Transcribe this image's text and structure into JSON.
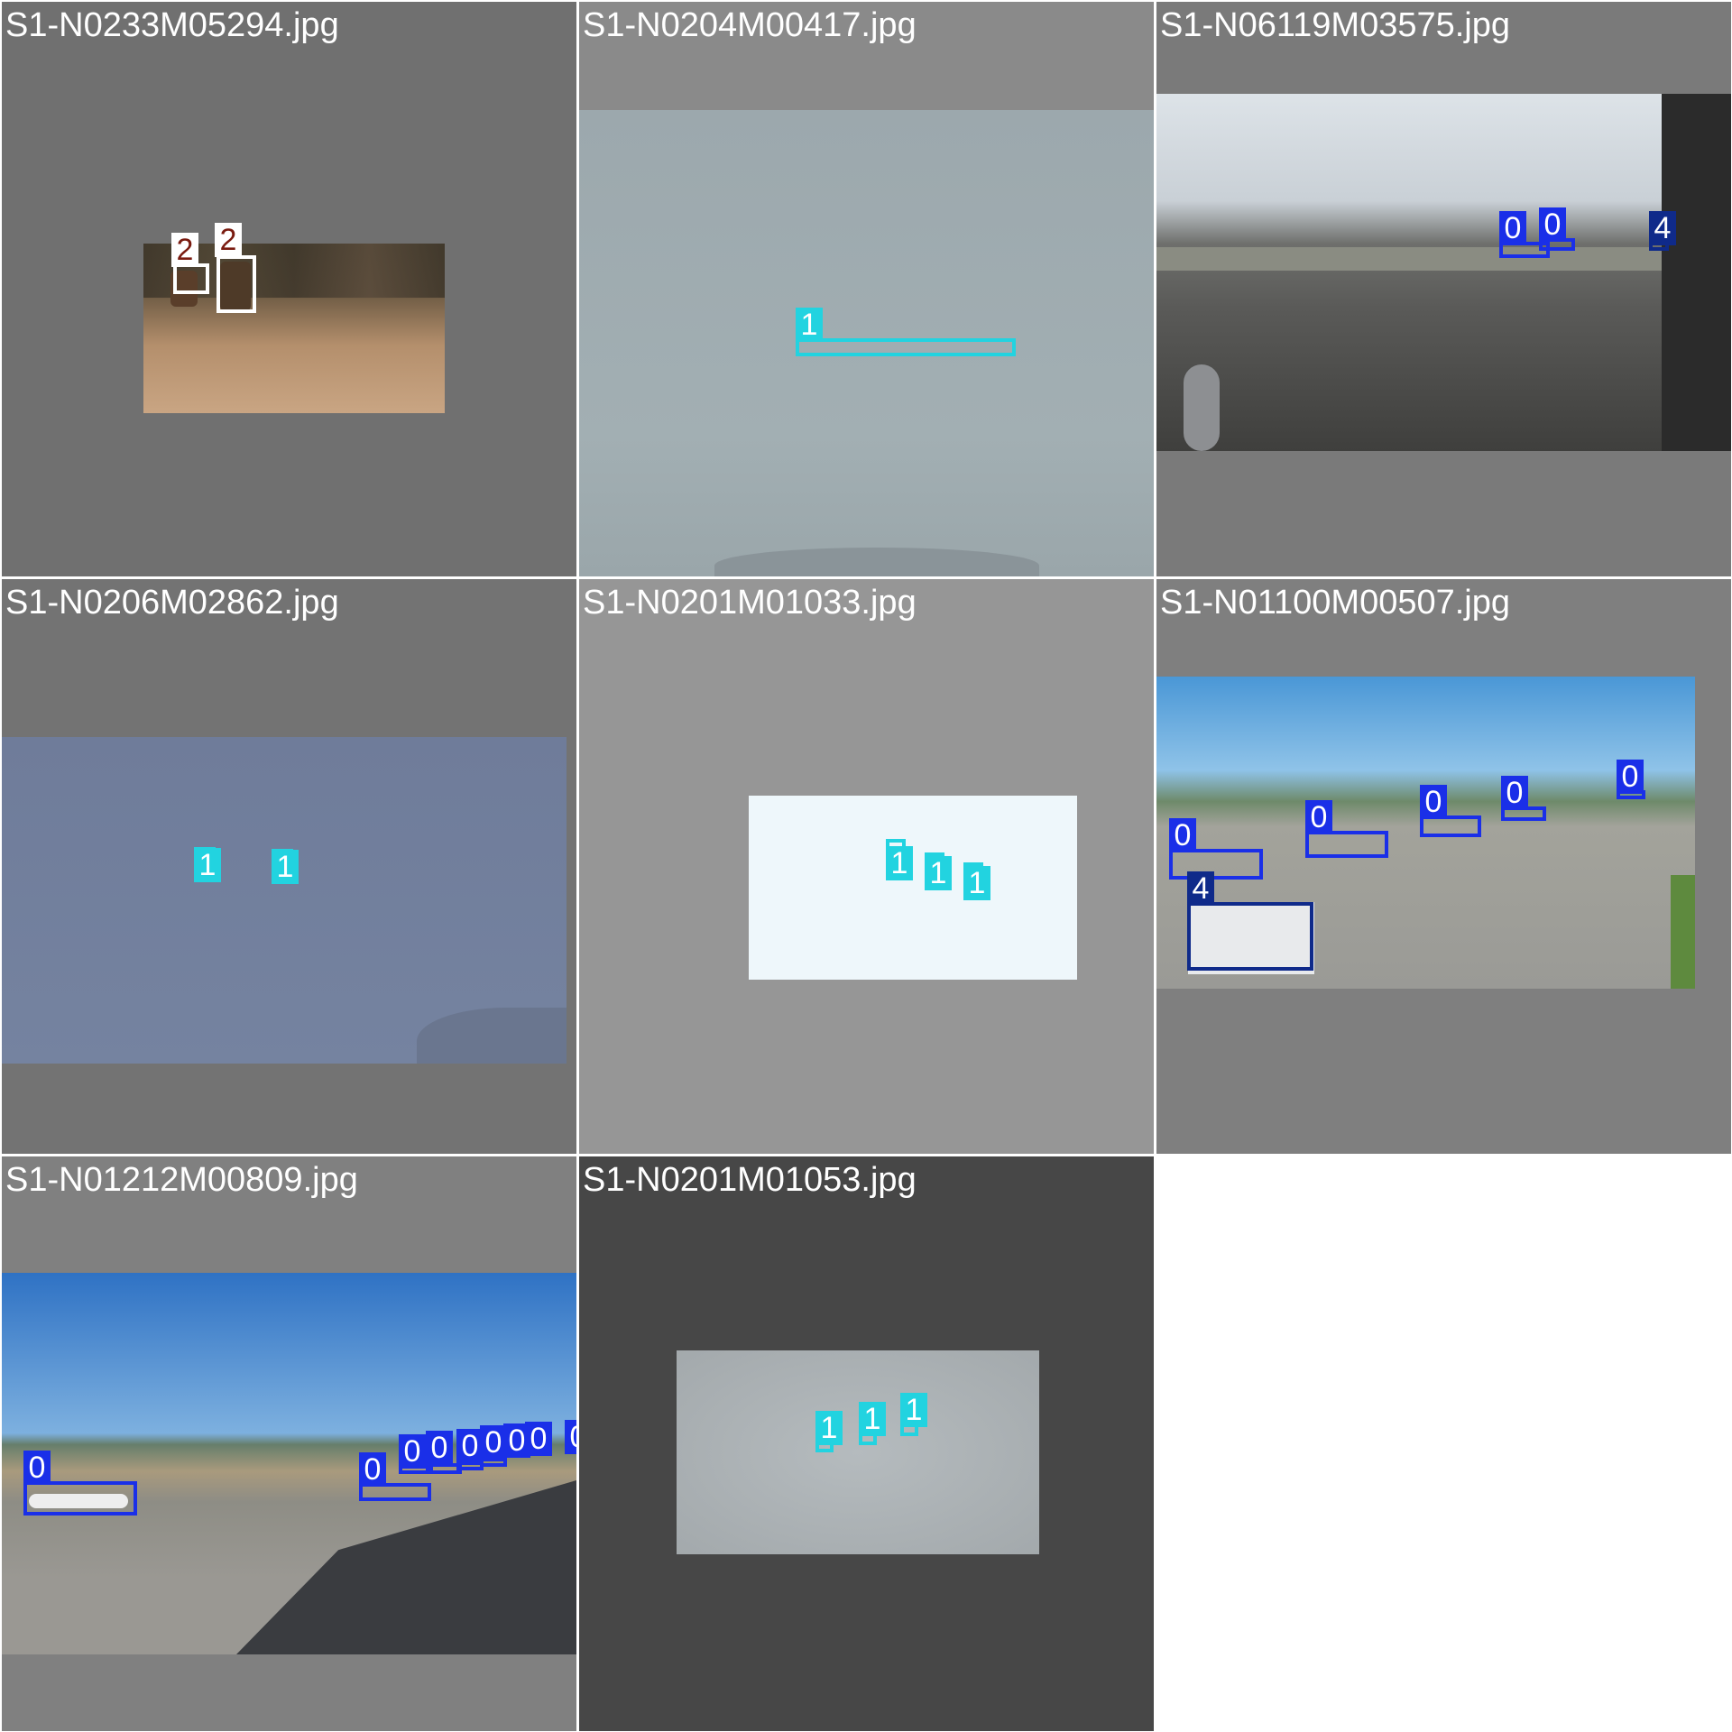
{
  "tiles": [
    {
      "filename": "S1-N0233M05294.jpg",
      "background": "#707070"
    },
    {
      "filename": "S1-N0204M00417.jpg",
      "background": "#8a8a8a"
    },
    {
      "filename": "S1-N06119M03575.jpg",
      "background": "#7a7a7a"
    },
    {
      "filename": "S1-N0206M02862.jpg",
      "background": "#737373"
    },
    {
      "filename": "S1-N0201M01033.jpg",
      "background": "#969696"
    },
    {
      "filename": "S1-N01100M00507.jpg",
      "background": "#7f7f7f"
    },
    {
      "filename": "S1-N01212M00809.jpg",
      "background": "#808080"
    },
    {
      "filename": "S1-N0201M01053.jpg",
      "background": "#474747"
    }
  ],
  "labels": {
    "l0": "0",
    "l1": "1",
    "l2": "2",
    "l4": "4"
  },
  "colors": {
    "class0": "#1a2fe8",
    "class1": "#22d3e0",
    "class2": "#ffffff",
    "class4": "#0f2a8a"
  }
}
